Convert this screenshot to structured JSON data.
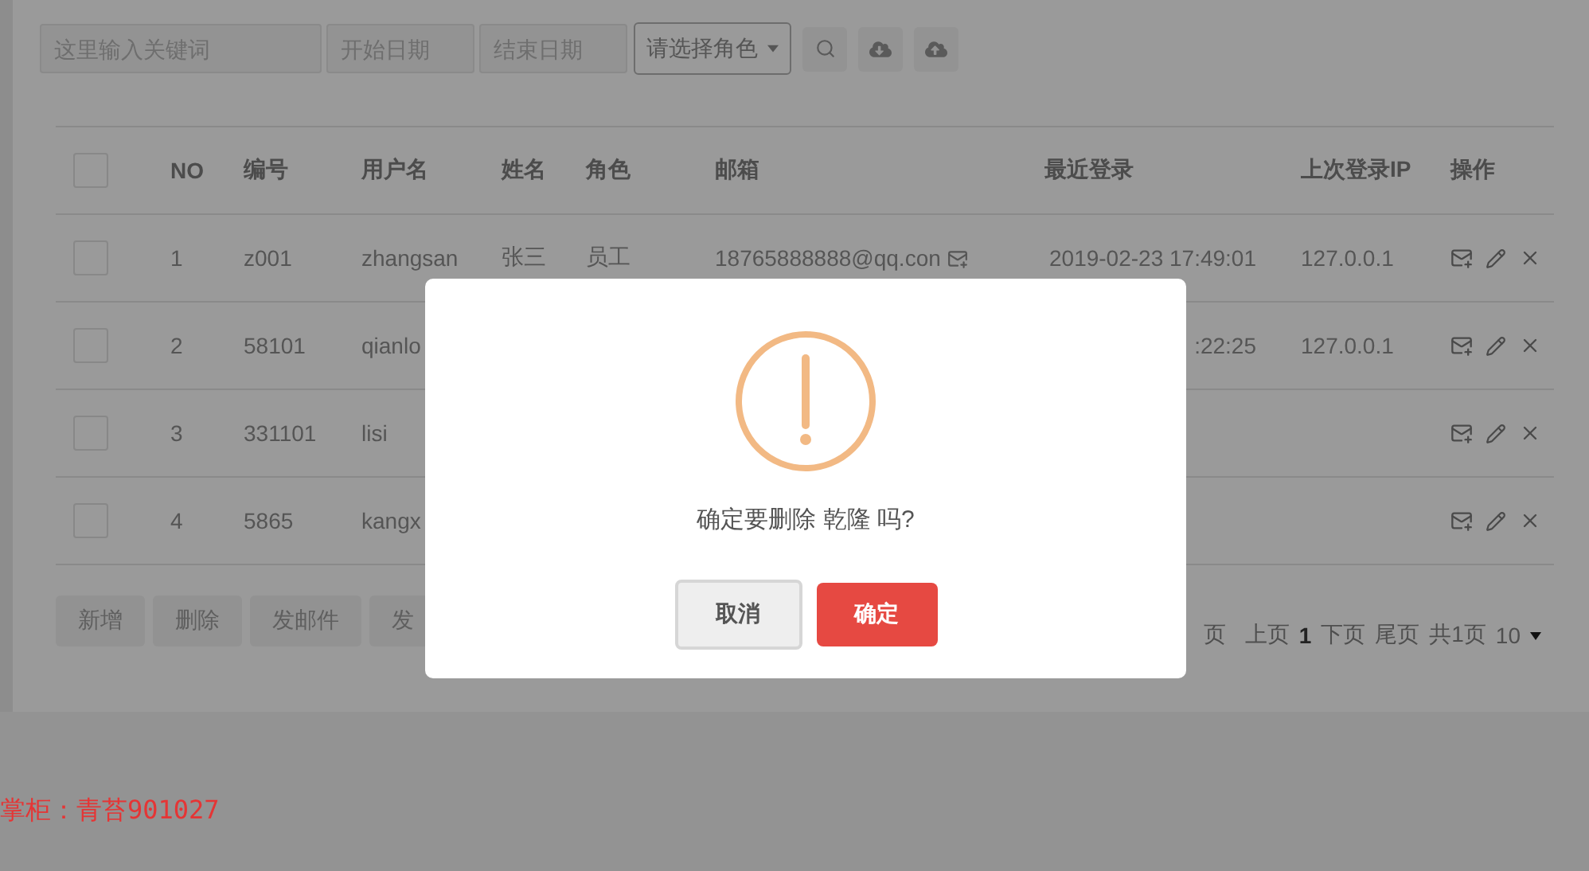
{
  "search_bar": {
    "keyword": {
      "placeholder": "这里输入关键词"
    },
    "start_date": {
      "placeholder": "开始日期"
    },
    "end_date": {
      "placeholder": "结束日期"
    },
    "role_select": {
      "value": "请选择角色"
    }
  },
  "table": {
    "header_checked": false,
    "columns": [
      "NO",
      "编号",
      "用户名",
      "姓名",
      "角色",
      "邮箱",
      "最近登录",
      "上次登录IP",
      "操作"
    ],
    "rows": [
      {
        "checked": false,
        "cells": [
          "1",
          "z001",
          "zhangsan",
          "张三",
          "员工",
          "18765888888@qq.con",
          "2019-02-23 17:49:01",
          "127.0.0.1"
        ]
      },
      {
        "checked": false,
        "cells": [
          "2",
          "58101",
          "qianlo",
          null,
          null,
          null,
          ":22:25",
          "127.0.0.1"
        ]
      },
      {
        "checked": false,
        "cells": [
          "3",
          "331101",
          "lisi",
          null,
          null,
          null,
          null,
          null
        ]
      },
      {
        "checked": false,
        "cells": [
          "4",
          "5865",
          "kangx",
          null,
          null,
          null,
          null,
          null
        ]
      }
    ]
  },
  "actions": [
    "新增",
    "删除",
    "发邮件",
    "发"
  ],
  "pagination": {
    "first": "页",
    "prev": "上页",
    "current": "1",
    "next": "下页",
    "last": "尾页",
    "total": "共1页",
    "page_size": "10"
  },
  "dialog": {
    "message": "确定要删除 乾隆 吗?",
    "buttons": [
      {
        "label": "取消",
        "kind": "cancel"
      },
      {
        "label": "确定",
        "kind": "confirm"
      }
    ]
  },
  "footer_note": "掌柜：青苔901027"
}
